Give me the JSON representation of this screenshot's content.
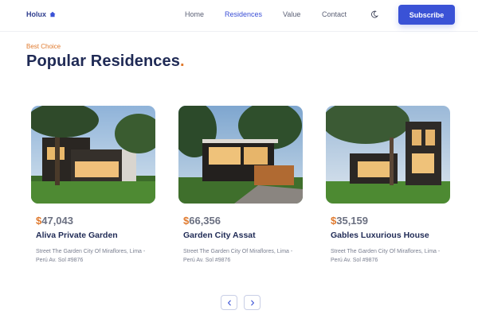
{
  "brand": {
    "name": "Holux",
    "icon": "home-icon"
  },
  "nav": {
    "home": "Home",
    "residences": "Residences",
    "value": "Value",
    "contact": "Contact",
    "theme_icon": "moon-icon",
    "subscribe": "Subscribe"
  },
  "section": {
    "eyebrow": "Best Choice",
    "title": "Popular Residences",
    "title_dot": "."
  },
  "cards": [
    {
      "currency": "$",
      "price": "47,043",
      "name": "Aliva Private Garden",
      "address": "Street The Garden City Of Miraflores, Lima - Perú Av. Sol #9876"
    },
    {
      "currency": "$",
      "price": "66,356",
      "name": "Garden City Assat",
      "address": "Street The Garden City Of Miraflores, Lima - Perú Av. Sol #9876"
    },
    {
      "currency": "$",
      "price": "35,159",
      "name": "Gables Luxurious House",
      "address": "Street The Garden City Of Miraflores, Lima - Perú Av. Sol #9876"
    }
  ],
  "pager": {
    "prev_icon": "chevron-left-icon",
    "next_icon": "chevron-right-icon"
  },
  "colors": {
    "accent": "#3a52d6",
    "highlight": "#e07a2e",
    "heading": "#1f2a55"
  }
}
